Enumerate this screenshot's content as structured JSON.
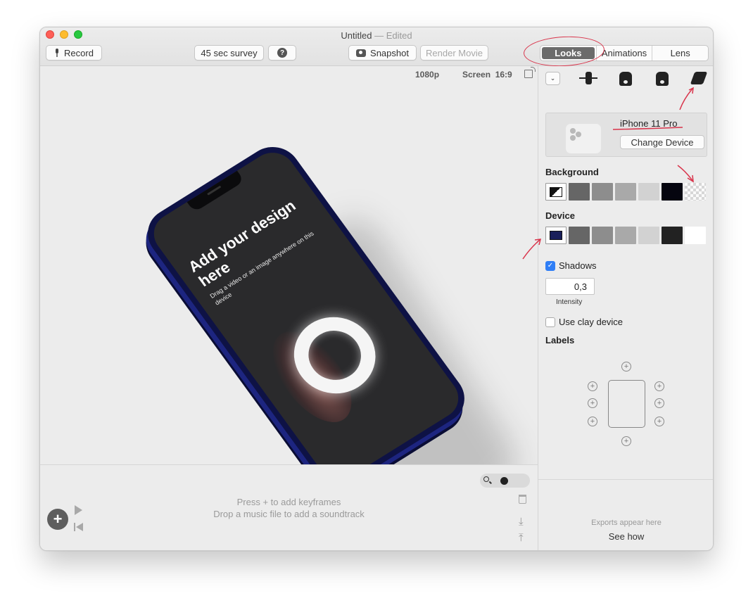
{
  "window": {
    "title": "Untitled",
    "title_suffix": "— Edited"
  },
  "toolbar": {
    "record_label": "Record",
    "survey_label": "45 sec survey",
    "help_label": "?",
    "snapshot_label": "Snapshot",
    "render_label": "Render Movie",
    "tabs": [
      {
        "label": "Looks",
        "active": true
      },
      {
        "label": "Animations",
        "active": false
      },
      {
        "label": "Lens",
        "active": false
      }
    ]
  },
  "canvas": {
    "resolution": "1080p",
    "screen": "Screen",
    "aspect": "16:9",
    "phone_title": "Add your design here",
    "phone_subtitle": "Drag a video or an image anywhere on this device"
  },
  "sidebar": {
    "device_name": "iPhone 11 Pro",
    "change_device_label": "Change Device",
    "background_label": "Background",
    "background_swatches": [
      "#ffffff",
      "#666666",
      "#8d8d8d",
      "#a9a9a9",
      "#d2d2d2",
      "#05050f",
      "checker"
    ],
    "device_label": "Device",
    "device_swatches": [
      "#1a1f5a",
      "#666666",
      "#8d8d8d",
      "#a9a9a9",
      "#d2d2d2",
      "#222222",
      "#ffffff"
    ],
    "shadows_label": "Shadows",
    "shadows_checked": true,
    "intensity_value": "0,3",
    "intensity_label": "Intensity",
    "clay_label": "Use clay device",
    "clay_checked": false,
    "labels_label": "Labels",
    "exports_hint": "Exports appear here",
    "see_how_label": "See how"
  },
  "timeline": {
    "hint_keyframes": "Press + to add keyframes",
    "hint_soundtrack": "Drop a music file to add a soundtrack"
  },
  "accent_colors": {
    "annotation_red": "#d9344b",
    "checkbox_blue": "#2f7ef6"
  }
}
